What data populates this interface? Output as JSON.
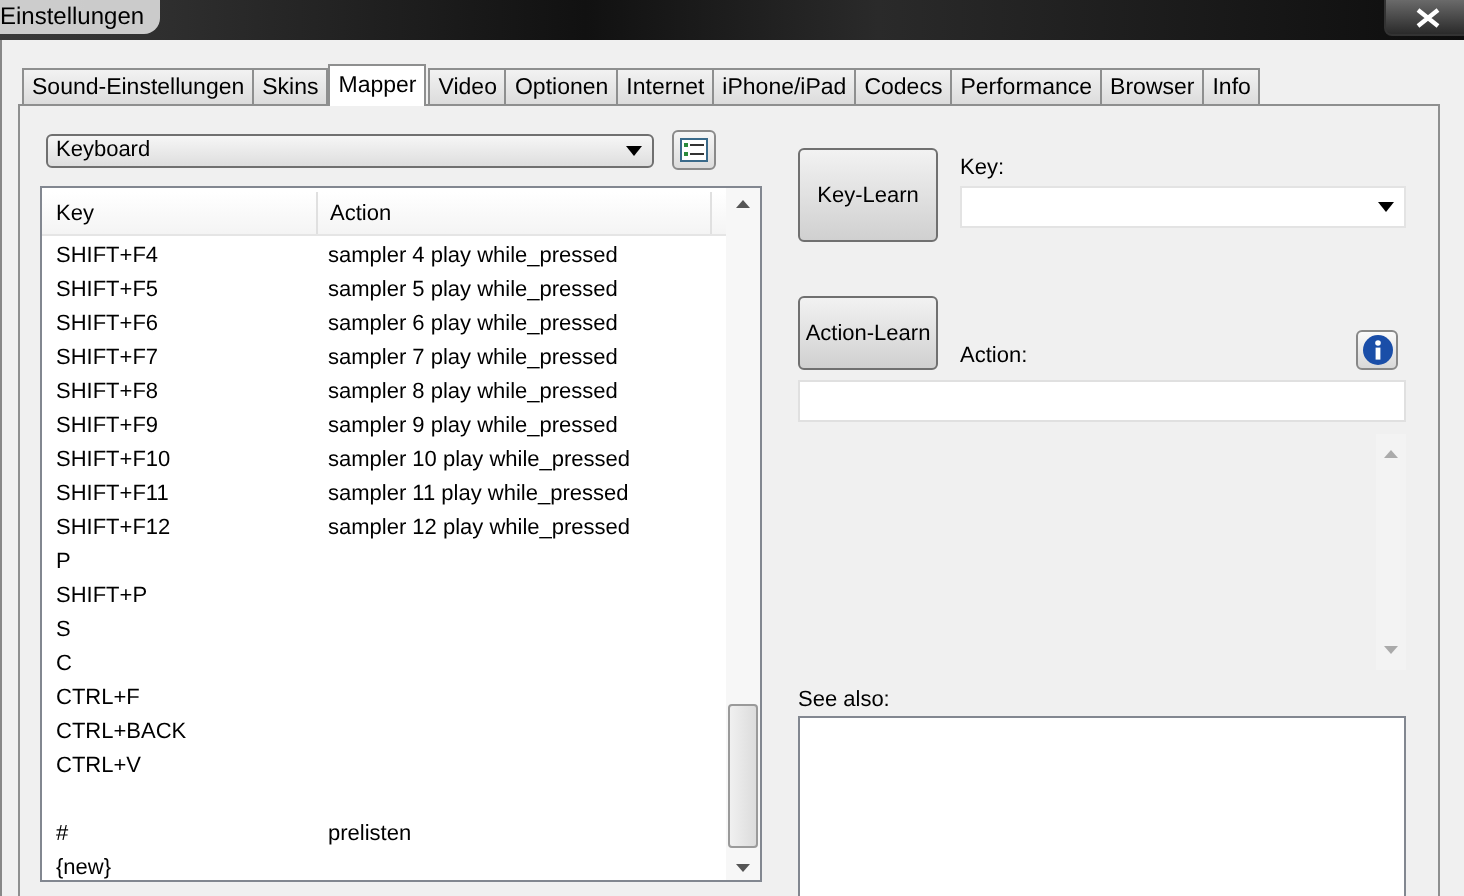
{
  "window": {
    "title": "Einstellungen"
  },
  "tabs": [
    {
      "label": "Sound-Einstellungen",
      "selected": false
    },
    {
      "label": "Skins",
      "selected": false
    },
    {
      "label": "Mapper",
      "selected": true
    },
    {
      "label": "Video",
      "selected": false
    },
    {
      "label": "Optionen",
      "selected": false
    },
    {
      "label": "Internet",
      "selected": false
    },
    {
      "label": "iPhone/iPad",
      "selected": false
    },
    {
      "label": "Codecs",
      "selected": false
    },
    {
      "label": "Performance",
      "selected": false
    },
    {
      "label": "Browser",
      "selected": false
    },
    {
      "label": "Info",
      "selected": false
    }
  ],
  "device_select": {
    "value": "Keyboard"
  },
  "table": {
    "columns": [
      "Key",
      "Action"
    ],
    "rows": [
      {
        "kind": "entry",
        "key": "SHIFT+F4",
        "action": "sampler 4 play while_pressed"
      },
      {
        "kind": "entry",
        "key": "SHIFT+F5",
        "action": "sampler 5 play while_pressed"
      },
      {
        "kind": "entry",
        "key": "SHIFT+F6",
        "action": "sampler 6 play while_pressed"
      },
      {
        "kind": "entry",
        "key": "SHIFT+F7",
        "action": "sampler 7 play while_pressed"
      },
      {
        "kind": "entry",
        "key": "SHIFT+F8",
        "action": "sampler 8 play while_pressed"
      },
      {
        "kind": "entry",
        "key": "SHIFT+F9",
        "action": "sampler 9 play while_pressed"
      },
      {
        "kind": "entry",
        "key": "SHIFT+F10",
        "action": "sampler 10 play while_pressed"
      },
      {
        "kind": "entry",
        "key": "SHIFT+F11",
        "action": "sampler 11 play while_pressed"
      },
      {
        "kind": "entry",
        "key": "SHIFT+F12",
        "action": "sampler 12 play while_pressed"
      },
      {
        "kind": "entry",
        "key": "P"
      },
      {
        "kind": "entry",
        "key": "SHIFT+P"
      },
      {
        "kind": "entry",
        "key": "S"
      },
      {
        "kind": "entry",
        "key": "C"
      },
      {
        "kind": "entry",
        "key": "CTRL+F"
      },
      {
        "kind": "entry",
        "key": "CTRL+BACK"
      },
      {
        "kind": "entry",
        "key": "CTRL+V"
      },
      {
        "kind": "blank"
      },
      {
        "kind": "entry",
        "key": "#",
        "action": "prelisten"
      },
      {
        "kind": "entry",
        "key": "{new}"
      }
    ]
  },
  "key_learn": {
    "button": "Key-Learn",
    "label": "Key:"
  },
  "action_learn": {
    "button": "Action-Learn",
    "label": "Action:"
  },
  "see_also": {
    "label": "See also:"
  }
}
